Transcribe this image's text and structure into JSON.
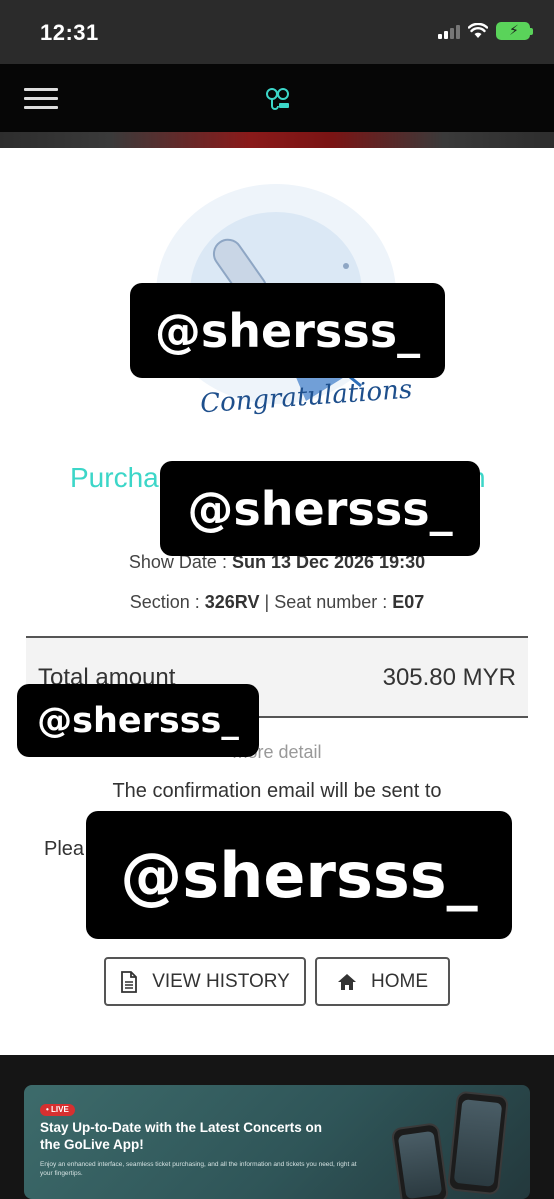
{
  "status_bar": {
    "time": "12:31"
  },
  "header": {
    "logo_icon": "golive-logo-icon",
    "menu_icon": "hamburger-icon"
  },
  "congrats": {
    "illustration_text": "Congratulations"
  },
  "purchase": {
    "title_start": "Purcha",
    "title_end": "n"
  },
  "details": {
    "show_date_label": "Show Date :",
    "show_date_value": "Sun 13 Dec 2026 19:30",
    "section_label": "Section :",
    "section_value": "326RV",
    "separator": "|",
    "seat_label": "Seat number :",
    "seat_value": "E07"
  },
  "total": {
    "label": "Total amount",
    "value": "305.80 MYR"
  },
  "more_detail": "more detail",
  "confirmation": {
    "email_text": "The confirmation email will be sent to",
    "please_text": "Plea"
  },
  "buttons": {
    "view_history": "VIEW HISTORY",
    "home": "HOME"
  },
  "banner": {
    "badge": "• LIVE",
    "title": "Stay Up-to-Date with the Latest Concerts on the GoLive App!",
    "subtitle": "Enjoy an enhanced interface, seamless ticket purchasing, and all the information and tickets you need, right at your fingertips."
  },
  "overlays": {
    "watermark": "@shersss_"
  },
  "colors": {
    "accent_teal": "#3cd6c8",
    "header_bg": "#060606",
    "congrats_blue": "#1e4f8c",
    "battery_green": "#5ad35a"
  }
}
